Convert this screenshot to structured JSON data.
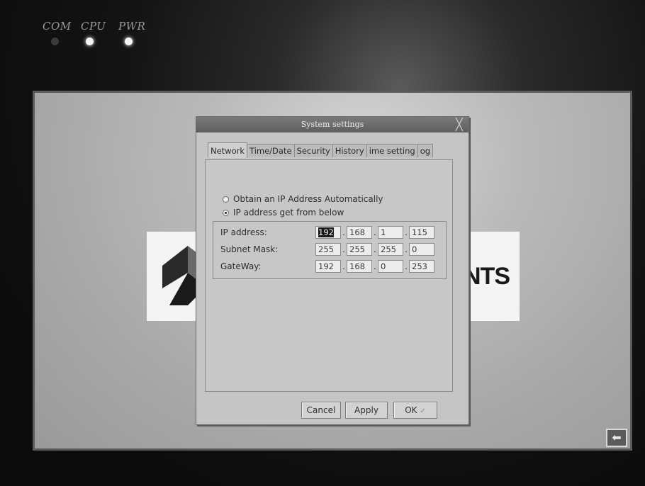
{
  "device": {
    "leds": [
      {
        "label": "COM",
        "state": "off"
      },
      {
        "label": "CPU",
        "state": "on"
      },
      {
        "label": "PWR",
        "state": "on"
      }
    ]
  },
  "background": {
    "logo_text": "NTS",
    "corner_icon": "back-arrow-icon"
  },
  "dialog": {
    "title": "System settings",
    "close_icon": "close-icon",
    "tabs": [
      {
        "label": "Network",
        "active": true
      },
      {
        "label": "Time/Date",
        "active": false
      },
      {
        "label": "Security",
        "active": false
      },
      {
        "label": "History",
        "active": false
      },
      {
        "label": "ime setting",
        "active": false
      },
      {
        "label": "og",
        "active": false
      }
    ],
    "radio_auto": "Obtain an IP Address Automatically",
    "radio_manual": "IP address get from below",
    "ip_address_label": "IP address:",
    "subnet_mask_label": "Subnet Mask:",
    "gateway_label": "GateWay:",
    "ip_address": [
      "192",
      "168",
      "1",
      "115"
    ],
    "subnet_mask": [
      "255",
      "255",
      "255",
      "0"
    ],
    "gateway": [
      "192",
      "168",
      "0",
      "253"
    ],
    "buttons": {
      "cancel": "Cancel",
      "apply": "Apply",
      "ok": "OK"
    }
  }
}
